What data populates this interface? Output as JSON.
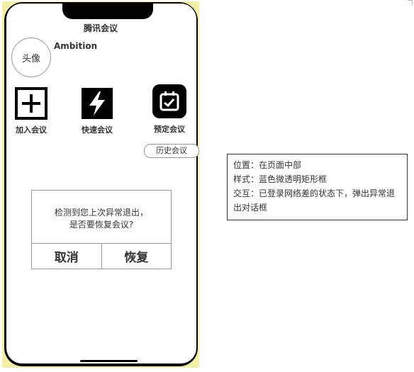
{
  "app": {
    "title": "腾讯会议",
    "avatar_label": "头像",
    "username": "Ambition"
  },
  "actions": [
    {
      "label": "加入会议",
      "icon": "plus-square-icon"
    },
    {
      "label": "快速会议",
      "icon": "lightning-icon"
    },
    {
      "label": "预定会议",
      "icon": "calendar-check-icon"
    }
  ],
  "history_button": "历史会议",
  "dialog": {
    "message_line1": "检测到您上次异常退出，",
    "message_line2": "是否要恢复会议?",
    "cancel_label": "取消",
    "restore_label": "恢复"
  },
  "annotation": {
    "line1": "位置：在页面中部",
    "line2": "样式：蓝色微透明矩形框",
    "line3": "交互：已登录网络差的状态下，弹出异常退出对话框"
  },
  "colors": {
    "icon_fill": "#000000",
    "phone_outline": "#f3f0a6",
    "border": "#999999",
    "text": "#333333"
  }
}
